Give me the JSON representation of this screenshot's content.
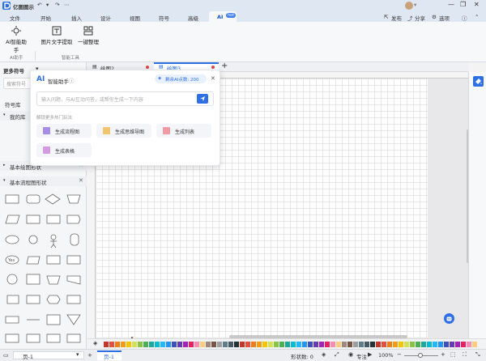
{
  "app": {
    "title": "亿图图示"
  },
  "titlebar": {
    "publish": "发布",
    "share": "分享",
    "options": "选项"
  },
  "menu": {
    "items": [
      "文件",
      "开始",
      "插入",
      "设计",
      "视图",
      "符号",
      "高级",
      "AI"
    ],
    "ai_badge": "hot"
  },
  "ribbon": {
    "buttons": [
      {
        "label": "AI智能助手"
      },
      {
        "label": "图片文字提取"
      },
      {
        "label": "一键整理"
      }
    ],
    "groups": [
      "AI助手",
      "智能工具"
    ]
  },
  "sidebar": {
    "header": "更多符号",
    "search_placeholder": "搜索符号",
    "library_label": "符号库",
    "my_library": "我的库",
    "section_basic": "基本绘图形状",
    "section_flow": "基本流程图形状",
    "yes_label": "Yes"
  },
  "tabs": [
    {
      "label": "绘图2"
    },
    {
      "label": "绘图3"
    }
  ],
  "ai_dialog": {
    "title": "智能助手",
    "points": "剩余AI点数: 200",
    "input_placeholder": "输入问题，与AI互动问答，或帮你生成一下内容",
    "hint": "解锁更多热门玩法",
    "actions": [
      {
        "label": "生成流程图"
      },
      {
        "label": "生成思维导图"
      },
      {
        "label": "生成列表"
      },
      {
        "label": "生成表格"
      }
    ]
  },
  "status": {
    "page_select": "页-1",
    "page_tab": "页-1",
    "shape_count": "形状数: 0",
    "focus": "专注",
    "zoom": "100%"
  },
  "colors": {
    "accent": "#1a56c8",
    "ai_blue": "#2f6fe4",
    "tab_dot": "#e0474c"
  }
}
